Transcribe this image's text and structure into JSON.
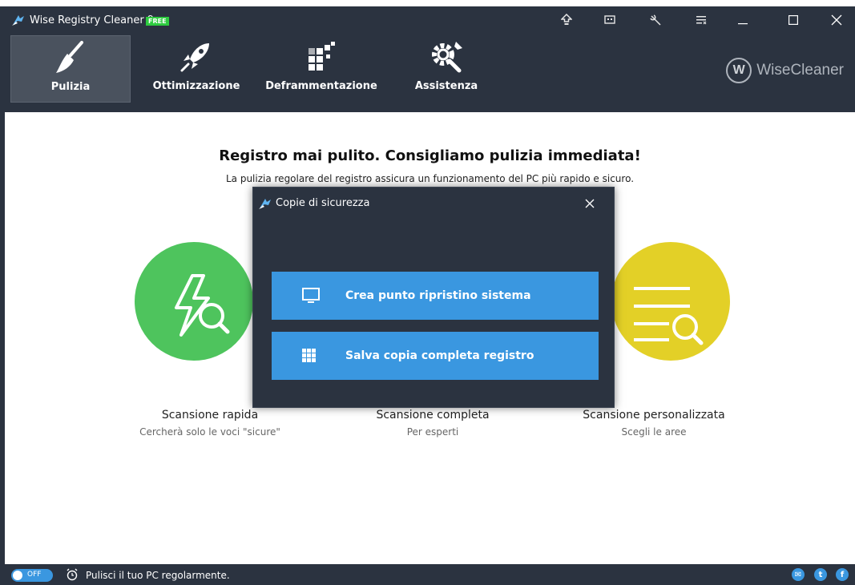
{
  "window": {
    "title": "Wise Registry Cleaner 9",
    "badge": "FREE",
    "controls": [
      "minimize",
      "maximize",
      "close"
    ]
  },
  "titlebar_icons": [
    "upgrade-icon",
    "feedback-icon",
    "tools-icon",
    "menu-icon"
  ],
  "toolbar": {
    "tabs": [
      {
        "label": "Pulizia",
        "icon": "broom-icon",
        "active": true
      },
      {
        "label": "Ottimizzazione",
        "icon": "rocket-icon",
        "active": false
      },
      {
        "label": "Deframmentazione",
        "icon": "defrag-icon",
        "active": false
      },
      {
        "label": "Assistenza",
        "icon": "gear-wrench-icon",
        "active": false
      }
    ],
    "brand_letter": "W",
    "brand_name": "WiseCleaner"
  },
  "main": {
    "headline": "Registro mai pulito. Consigliamo pulizia immediata!",
    "subline": "La pulizia regolare del registro assicura un funzionamento del PC più rapido e sicuro.",
    "scans": [
      {
        "title": "Scansione rapida",
        "subtitle": "Cercherà solo le voci \"sicure\"",
        "color": "#4ec45d"
      },
      {
        "title": "Scansione completa",
        "subtitle": "Per esperti",
        "color": "#3a97e0"
      },
      {
        "title": "Scansione personalizzata",
        "subtitle": "Scegli le aree",
        "color": "#e3d027"
      }
    ]
  },
  "dialog": {
    "title": "Copie di sicurezza",
    "buttons": [
      {
        "label": "Crea punto ripristino sistema",
        "icon": "monitor-icon"
      },
      {
        "label": "Salva copia completa registro",
        "icon": "grid-icon"
      }
    ]
  },
  "statusbar": {
    "toggle_label": "OFF",
    "text": "Pulisci il tuo PC regolarmente.",
    "social": [
      "mail-icon",
      "twitter-icon",
      "facebook-icon"
    ],
    "social_glyphs": [
      "✉",
      "t",
      "f"
    ]
  },
  "colors": {
    "dark": "#2b3340",
    "accent": "#3a97e0",
    "green": "#4ec45d",
    "yellow": "#e3d027"
  }
}
